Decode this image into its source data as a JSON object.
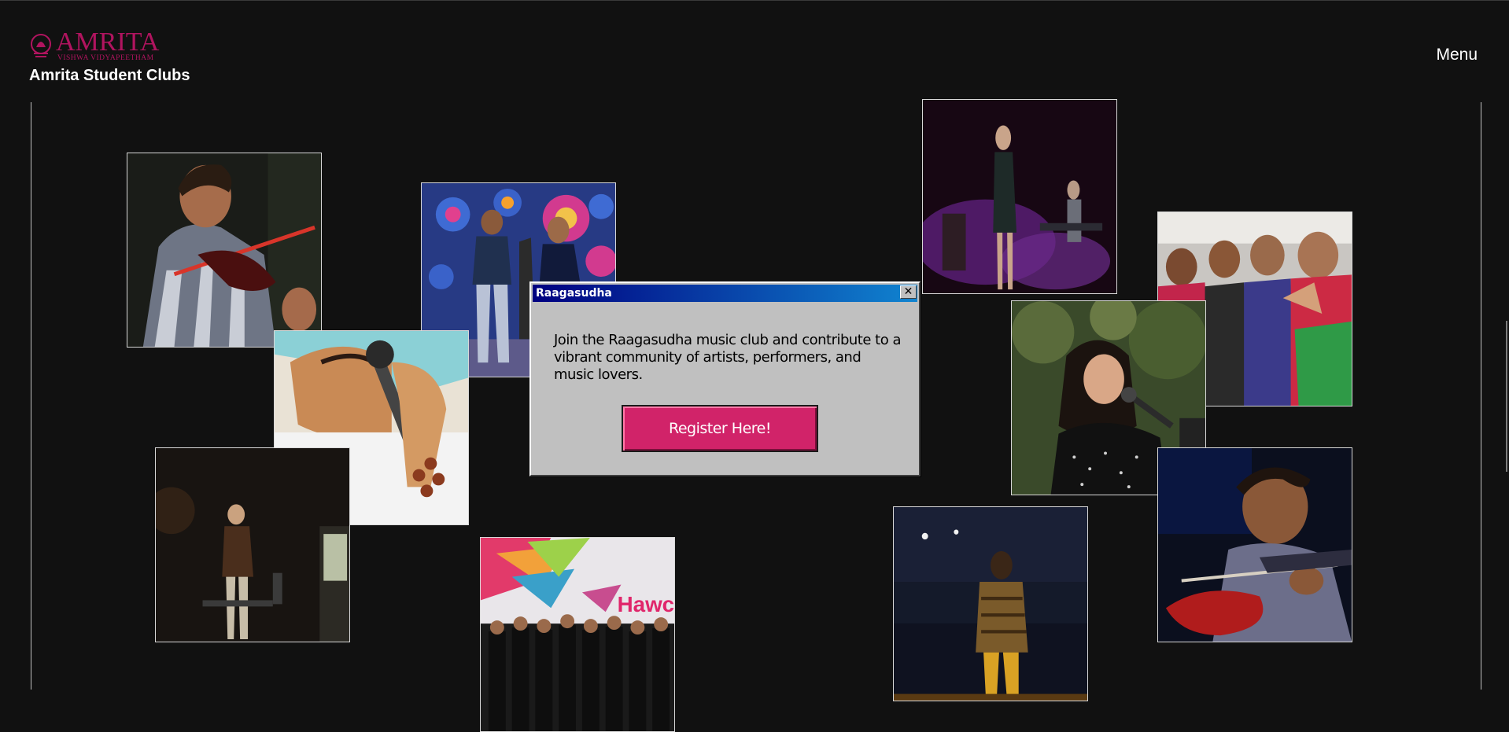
{
  "header": {
    "logo_text": "AMRITA",
    "logo_subtext": "VISHWA VIDYAPEETHAM",
    "site_title": "Amrita Student Clubs",
    "menu_label": "Menu"
  },
  "dialog": {
    "title": "Raagasudha",
    "close_glyph": "✕",
    "body": "Join the Raagasudha music club and contribute to a vibrant community of artists, performers, and music lovers.",
    "button_label": "Register Here!"
  },
  "gallery": {
    "banner_text": "Hawc"
  },
  "colors": {
    "background": "#111111",
    "brand_magenta": "#b0145f",
    "button": "#d12369",
    "dialog_face": "#c0c0c0",
    "titlebar_start": "#000080",
    "titlebar_end": "#1084d0"
  },
  "icons": {
    "logo": "amrita-emblem-icon",
    "close": "close-icon"
  }
}
